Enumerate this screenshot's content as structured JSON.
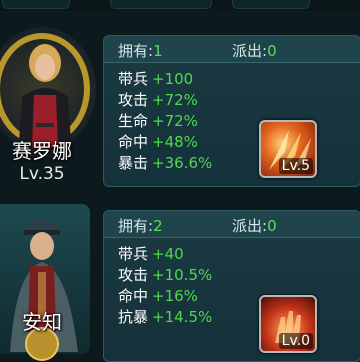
{
  "heroes": [
    {
      "name": "赛罗娜",
      "level": "Lv.35",
      "owned_label": "拥有:",
      "owned_value": "1",
      "dispatched_label": "派出:",
      "dispatched_value": "0",
      "stats": [
        {
          "name": "带兵",
          "value": "+100"
        },
        {
          "name": "攻击",
          "value": "+72%"
        },
        {
          "name": "生命",
          "value": "+72%"
        },
        {
          "name": "命中",
          "value": "+48%"
        },
        {
          "name": "暴击",
          "value": "+36.6%"
        }
      ],
      "skill_level": "Lv.5",
      "skill_icon": "fire-claw-skill-icon"
    },
    {
      "name": "安知",
      "owned_label": "拥有:",
      "owned_value": "2",
      "dispatched_label": "派出:",
      "dispatched_value": "0",
      "stats": [
        {
          "name": "带兵",
          "value": "+40"
        },
        {
          "name": "攻击",
          "value": "+10.5%"
        },
        {
          "name": "命中",
          "value": "+16%"
        },
        {
          "name": "抗暴",
          "value": "+14.5%"
        }
      ],
      "skill_level": "Lv.0",
      "skill_icon": "fire-hand-skill-icon"
    }
  ],
  "colors": {
    "bonus_green": "#4fd84f",
    "panel": "#1b3a41",
    "gold_ring": "#d7b43a"
  }
}
